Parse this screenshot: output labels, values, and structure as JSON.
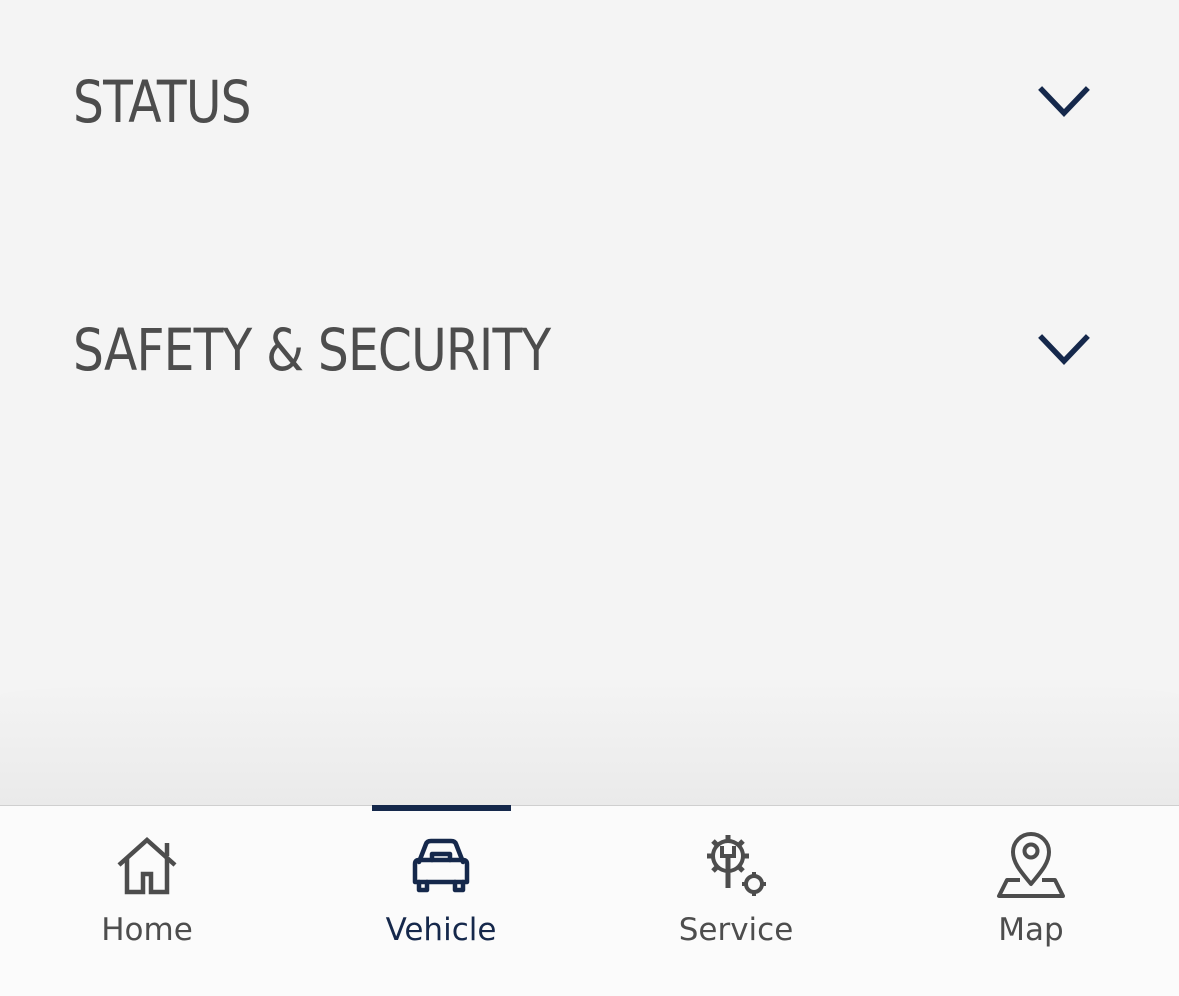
{
  "sections": [
    {
      "title": "STATUS",
      "expanded": false,
      "chevron_icon": "chevron-down-icon"
    },
    {
      "title": "SAFETY & SECURITY",
      "expanded": false,
      "chevron_icon": "chevron-down-icon"
    }
  ],
  "tabbar": {
    "active_tab": "Vehicle",
    "tabs": [
      {
        "label": "Home",
        "icon": "home-icon"
      },
      {
        "label": "Vehicle",
        "icon": "car-icon"
      },
      {
        "label": "Service",
        "icon": "service-gears-icon"
      },
      {
        "label": "Map",
        "icon": "map-pin-icon"
      }
    ]
  },
  "colors": {
    "accent": "#15284b",
    "text": "#4d4d4d",
    "background": "#f4f4f4"
  }
}
